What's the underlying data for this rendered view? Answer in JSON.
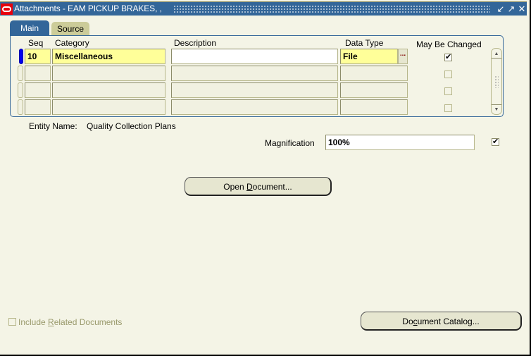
{
  "window": {
    "title": "Attachments - EAM PICKUP BRAKES, ,",
    "controls": {
      "minimize": "minimize-icon",
      "maximize": "maximize-icon",
      "close": "close-icon"
    }
  },
  "tabs": [
    {
      "label": "Main",
      "active": true
    },
    {
      "label": "Source",
      "active": false
    }
  ],
  "table": {
    "columns": [
      "Seq",
      "Category",
      "Description",
      "Data Type",
      "May Be Changed"
    ],
    "rows": [
      {
        "seq": "10",
        "category": "Miscellaneous",
        "description": "",
        "data_type": "File",
        "may_be_changed": true
      },
      {
        "seq": "",
        "category": "",
        "description": "",
        "data_type": "",
        "may_be_changed": false
      },
      {
        "seq": "",
        "category": "",
        "description": "",
        "data_type": "",
        "may_be_changed": false
      },
      {
        "seq": "",
        "category": "",
        "description": "",
        "data_type": "",
        "may_be_changed": false
      }
    ],
    "lov_label": "..."
  },
  "entity": {
    "label": "Entity Name:",
    "value": "Quality Collection Plans"
  },
  "magnification": {
    "label": "Magnification",
    "value": "100%",
    "checked": true
  },
  "buttons": {
    "open_document": {
      "pre": "Open ",
      "mnemonic": "D",
      "post": "ocument..."
    },
    "document_catalog": {
      "pre": "Do",
      "mnemonic": "c",
      "post": "ument Catalog..."
    }
  },
  "include_related": {
    "pre": "Include ",
    "mnemonic": "R",
    "post": "elated Documents",
    "checked": false,
    "enabled": false
  },
  "colors": {
    "titlebar": "#336699",
    "background": "#f4f4e6",
    "required_field": "#ffff99",
    "current_record": "#0000ee"
  }
}
